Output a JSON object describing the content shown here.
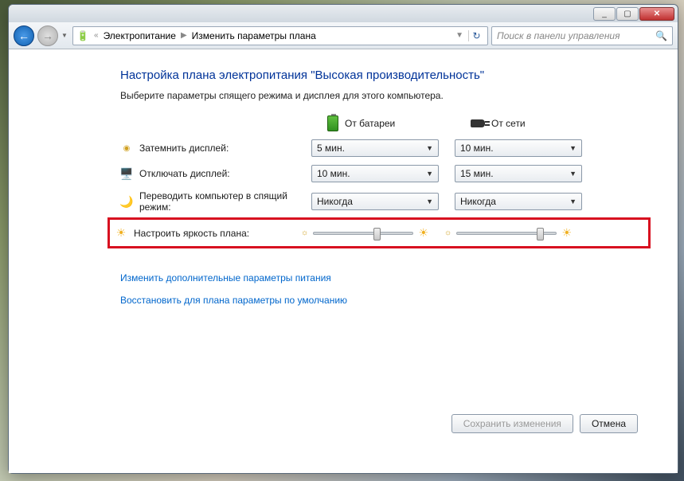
{
  "titlebar": {
    "min": "_",
    "max": "▢",
    "close": "✕"
  },
  "nav": {
    "breadcrumb_sep": "«",
    "crumb1": "Электропитание",
    "crumb2": "Изменить параметры плана",
    "search_placeholder": "Поиск в панели управления"
  },
  "heading": "Настройка плана электропитания \"Высокая производительность\"",
  "subheading": "Выберите параметры спящего режима и дисплея для этого компьютера.",
  "columns": {
    "battery": "От батареи",
    "ac": "От сети"
  },
  "rows": {
    "dim": {
      "label": "Затемнить дисплей:",
      "battery": "5 мин.",
      "ac": "10 мин."
    },
    "off": {
      "label": "Отключать дисплей:",
      "battery": "10 мин.",
      "ac": "15 мин."
    },
    "sleep": {
      "label": "Переводить компьютер в спящий режим:",
      "battery": "Никогда",
      "ac": "Никогда"
    },
    "bright": {
      "label": "Настроить яркость плана:",
      "battery_pct": 60,
      "ac_pct": 80
    }
  },
  "links": {
    "advanced": "Изменить дополнительные параметры питания",
    "restore": "Восстановить для плана параметры по умолчанию"
  },
  "buttons": {
    "save": "Сохранить изменения",
    "cancel": "Отмена"
  }
}
